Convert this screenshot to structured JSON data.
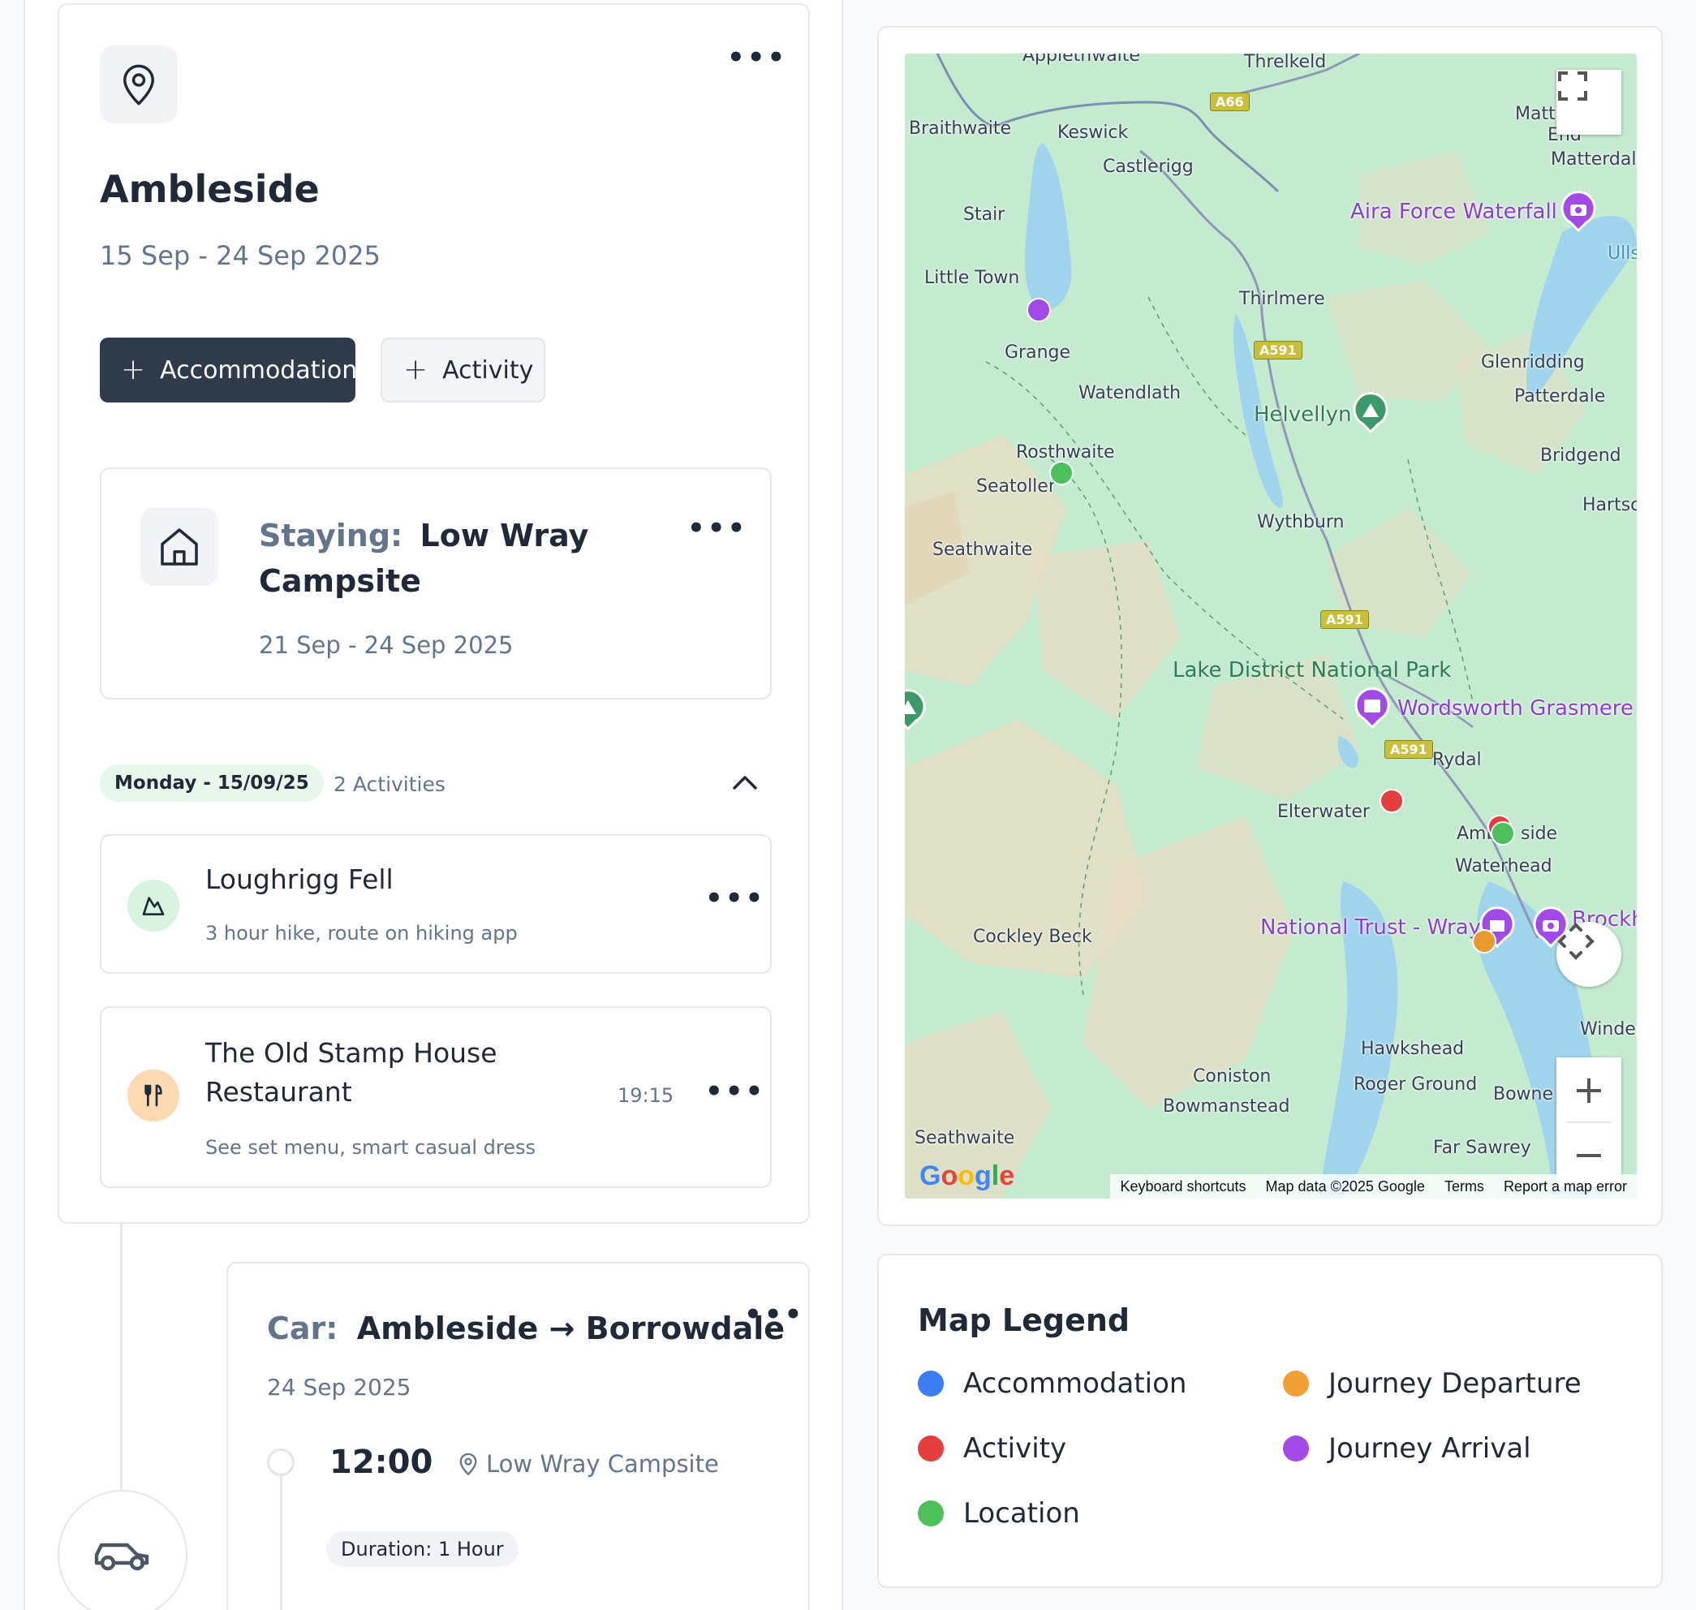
{
  "destination": {
    "title": "Ambleside",
    "dates": "15 Sep - 24 Sep 2025",
    "menu": "•••",
    "add_accommodation": "Accommodation",
    "add_activity": "Activity",
    "plus": "+"
  },
  "stay": {
    "prefix": "Staying:",
    "name": "Low Wray Campsite",
    "dates": "21 Sep - 24 Sep 2025",
    "menu": "•••"
  },
  "day": {
    "label": "Monday - 15/09/25",
    "count": "2 Activities"
  },
  "activities": [
    {
      "title": "Loughrigg Fell",
      "subtitle": "3 hour hike, route on hiking app",
      "time": "",
      "icon": "mountain-icon",
      "icon_bg": "#d8f3df",
      "menu": "•••"
    },
    {
      "title": "The Old Stamp House Restaurant",
      "subtitle": "See set menu, smart casual dress",
      "time": "19:15",
      "icon": "cutlery-icon",
      "icon_bg": "#fbd9b3",
      "menu": "•••"
    }
  ],
  "journey": {
    "prefix": "Car:",
    "route": "Ambleside → Borrowdale",
    "date": "24 Sep 2025",
    "departure_time": "12:00",
    "departure_location": "Low Wray Campsite",
    "duration": "Duration: 1 Hour",
    "menu": "•••"
  },
  "map": {
    "places": [
      "Applethwaite",
      "Threlkeld",
      "Braithwaite",
      "Keswick",
      "Castlerigg",
      "Matt",
      "End",
      "Matterdale",
      "Stair",
      "Little Town",
      "Thirlmere",
      "Grange",
      "Glenridding",
      "Watendlath",
      "Patterdale",
      "Rosthwaite",
      "Bridgend",
      "Seatoller",
      "Hartsc",
      "Wythburn",
      "Seathwaite",
      "Rydal",
      "Elterwater",
      "Amb",
      "side",
      "Waterhead",
      "Cockley Beck",
      "Hawkshead",
      "Coniston",
      "Roger Ground",
      "Bowne",
      "Bowmanstead",
      "Seathwaite",
      "Far Sawrey",
      "Windermere",
      "Ulls"
    ],
    "pois": [
      "Aira Force Waterfall",
      "Helvellyn",
      "Wordsworth Grasmere",
      "National Trust - Wray",
      "Brockhole"
    ],
    "park": "Lake District National Park",
    "roads": [
      "A66",
      "A591",
      "A591",
      "A591"
    ],
    "google": "Google",
    "attribution": [
      "Keyboard shortcuts",
      "Map data ©2025 Google",
      "Terms",
      "Report a map error"
    ],
    "zoom_in": "+",
    "zoom_out": "−",
    "pins": [
      {
        "type": "arrival",
        "color": "#a24ae8"
      },
      {
        "type": "location",
        "color": "#4cc05a"
      },
      {
        "type": "activity",
        "color": "#e53e3e"
      },
      {
        "type": "activity",
        "color": "#e53e3e"
      },
      {
        "type": "location",
        "color": "#4cc05a"
      },
      {
        "type": "departure",
        "color": "#e79b2f"
      }
    ]
  },
  "legend": {
    "title": "Map Legend",
    "items": [
      {
        "label": "Accommodation",
        "color": "#3b7cf0"
      },
      {
        "label": "Journey Departure",
        "color": "#f0a035"
      },
      {
        "label": "Activity",
        "color": "#e53e3e"
      },
      {
        "label": "Journey Arrival",
        "color": "#a24ae8"
      },
      {
        "label": "Location",
        "color": "#4cc05a"
      }
    ]
  }
}
